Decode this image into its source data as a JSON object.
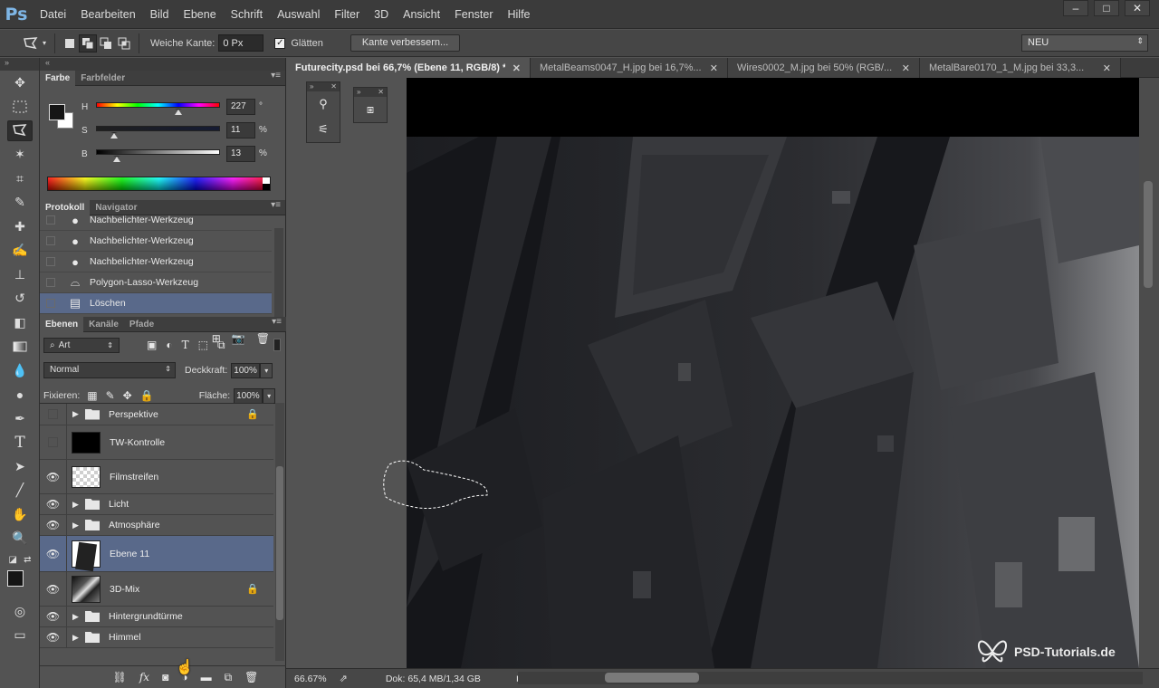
{
  "menubar": {
    "logo": "Ps",
    "items": [
      "Datei",
      "Bearbeiten",
      "Bild",
      "Ebene",
      "Schrift",
      "Auswahl",
      "Filter",
      "3D",
      "Ansicht",
      "Fenster",
      "Hilfe"
    ],
    "window_controls": [
      "–",
      "□",
      "✕"
    ]
  },
  "options": {
    "feather_label": "Weiche Kante:",
    "feather_value": "0 Px",
    "smooth_label": "Glätten",
    "refine_button": "Kante verbessern...",
    "workspace": "NEU"
  },
  "tabs": [
    {
      "label": "Futurecity.psd bei 66,7% (Ebene 11, RGB/8) *",
      "active": true
    },
    {
      "label": "MetalBeams0047_H.jpg bei 16,7%...",
      "active": false
    },
    {
      "label": "Wires0002_M.jpg bei 50% (RGB/...",
      "active": false
    },
    {
      "label": "MetalBare0170_1_M.jpg bei 33,3...",
      "active": false
    }
  ],
  "color_panel": {
    "tabs": [
      "Farbe",
      "Farbfelder"
    ],
    "sliders": [
      {
        "label": "H",
        "value": "227",
        "unit": "°",
        "thumb_fraction": 0.63,
        "gradient": "hue"
      },
      {
        "label": "S",
        "value": "11",
        "unit": "%",
        "thumb_fraction": 0.11,
        "gradient": "sat"
      },
      {
        "label": "B",
        "value": "13",
        "unit": "%",
        "thumb_fraction": 0.13,
        "gradient": "bri"
      }
    ],
    "fg_color": "#151515",
    "bg_color": "#ffffff"
  },
  "history_panel": {
    "tabs": [
      "Protokoll",
      "Navigator"
    ],
    "items": [
      {
        "label": "Nachbelichter-Werkzeug",
        "icon": "burn-tool-icon",
        "glyph": "●",
        "active": false
      },
      {
        "label": "Nachbelichter-Werkzeug",
        "icon": "burn-tool-icon",
        "glyph": "●",
        "active": false
      },
      {
        "label": "Nachbelichter-Werkzeug",
        "icon": "burn-tool-icon",
        "glyph": "●",
        "active": false
      },
      {
        "label": "Polygon-Lasso-Werkzeug",
        "icon": "polygon-lasso-icon",
        "glyph": "⌓",
        "active": false
      },
      {
        "label": "Löschen",
        "icon": "delete-doc-icon",
        "glyph": "▤",
        "active": true
      }
    ]
  },
  "layers_panel": {
    "tabs": [
      "Ebenen",
      "Kanäle",
      "Pfade"
    ],
    "filter_kind": "Art",
    "blend_mode": "Normal",
    "opacity_label": "Deckkraft:",
    "opacity_value": "100%",
    "lock_label": "Fixieren:",
    "fill_label": "Fläche:",
    "fill_value": "100%",
    "layers": [
      {
        "name": "Perspektive",
        "type": "group",
        "visible": false,
        "locked": true,
        "active": false
      },
      {
        "name": "TW-Kontrolle",
        "type": "layer",
        "thumb": "black",
        "visible": false,
        "locked": false,
        "active": false
      },
      {
        "name": "Filmstreifen",
        "type": "layer",
        "thumb": "checker",
        "visible": true,
        "locked": false,
        "active": false
      },
      {
        "name": "Licht",
        "type": "group",
        "visible": true,
        "locked": false,
        "active": false
      },
      {
        "name": "Atmosphäre",
        "type": "group",
        "visible": true,
        "locked": false,
        "active": false
      },
      {
        "name": "Ebene 11",
        "type": "layer",
        "thumb": "dark",
        "visible": true,
        "locked": false,
        "active": true
      },
      {
        "name": "3D-Mix",
        "type": "layer",
        "thumb": "mix",
        "visible": true,
        "locked": true,
        "active": false
      },
      {
        "name": "Hintergrundtürme",
        "type": "group",
        "visible": true,
        "locked": false,
        "active": false
      },
      {
        "name": "Himmel",
        "type": "group",
        "visible": true,
        "locked": false,
        "active": false
      }
    ]
  },
  "status": {
    "zoom": "66.67%",
    "doc_info": "Dok: 65,4 MB/1,34 GB"
  },
  "watermark": "PSD-Tutorials.de"
}
